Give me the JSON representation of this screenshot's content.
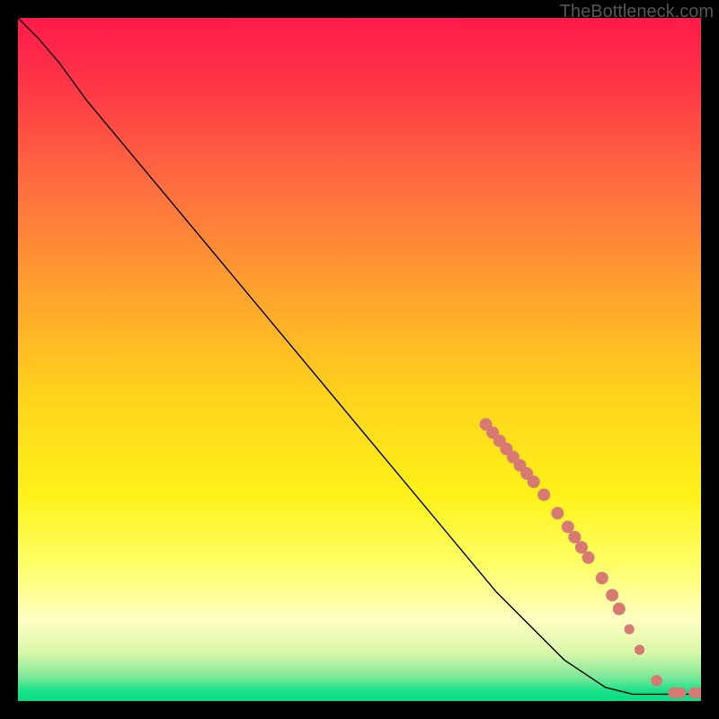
{
  "watermark": "TheBottleneck.com",
  "chart_data": {
    "type": "line",
    "title": "",
    "xlabel": "",
    "ylabel": "",
    "xlim": [
      0,
      100
    ],
    "ylim": [
      0,
      100
    ],
    "grid": false,
    "curve": [
      {
        "x": 0,
        "y": 100
      },
      {
        "x": 3,
        "y": 97
      },
      {
        "x": 6,
        "y": 93.5
      },
      {
        "x": 10,
        "y": 88
      },
      {
        "x": 20,
        "y": 76
      },
      {
        "x": 30,
        "y": 64
      },
      {
        "x": 40,
        "y": 52
      },
      {
        "x": 50,
        "y": 40
      },
      {
        "x": 60,
        "y": 28
      },
      {
        "x": 70,
        "y": 16
      },
      {
        "x": 80,
        "y": 6
      },
      {
        "x": 86,
        "y": 2
      },
      {
        "x": 90,
        "y": 1
      },
      {
        "x": 95,
        "y": 1
      },
      {
        "x": 100,
        "y": 1
      }
    ],
    "markers": [
      {
        "x": 68.5,
        "y": 40.5,
        "r": 1.0
      },
      {
        "x": 69.5,
        "y": 39.3,
        "r": 1.0
      },
      {
        "x": 70.5,
        "y": 38.1,
        "r": 1.0
      },
      {
        "x": 71.5,
        "y": 36.9,
        "r": 1.0
      },
      {
        "x": 72.5,
        "y": 35.7,
        "r": 1.0
      },
      {
        "x": 73.5,
        "y": 34.5,
        "r": 1.0
      },
      {
        "x": 74.5,
        "y": 33.3,
        "r": 1.0
      },
      {
        "x": 75.5,
        "y": 32.1,
        "r": 1.0
      },
      {
        "x": 77.0,
        "y": 30.2,
        "r": 1.0
      },
      {
        "x": 79.0,
        "y": 27.5,
        "r": 1.0
      },
      {
        "x": 80.5,
        "y": 25.5,
        "r": 1.0
      },
      {
        "x": 81.5,
        "y": 24.0,
        "r": 1.0
      },
      {
        "x": 82.5,
        "y": 22.5,
        "r": 1.0
      },
      {
        "x": 83.5,
        "y": 21.0,
        "r": 1.0
      },
      {
        "x": 85.5,
        "y": 18.0,
        "r": 1.0
      },
      {
        "x": 87.0,
        "y": 15.5,
        "r": 1.0
      },
      {
        "x": 88.0,
        "y": 13.5,
        "r": 1.0
      },
      {
        "x": 89.5,
        "y": 10.5,
        "r": 0.8
      },
      {
        "x": 91.0,
        "y": 7.5,
        "r": 0.8
      },
      {
        "x": 93.5,
        "y": 3.0,
        "r": 0.9
      },
      {
        "x": 96.0,
        "y": 1.2,
        "r": 0.9
      },
      {
        "x": 97.0,
        "y": 1.2,
        "r": 0.9
      },
      {
        "x": 99.0,
        "y": 1.2,
        "r": 0.9
      },
      {
        "x": 100.0,
        "y": 1.2,
        "r": 0.9
      }
    ],
    "marker_color": "#d77a74",
    "line_color": "#000000",
    "gradient_stops": [
      {
        "offset": 0.0,
        "color": "#ff1a4b"
      },
      {
        "offset": 0.1,
        "color": "#ff3747"
      },
      {
        "offset": 0.25,
        "color": "#ff6f3f"
      },
      {
        "offset": 0.4,
        "color": "#ffa22e"
      },
      {
        "offset": 0.55,
        "color": "#ffd21c"
      },
      {
        "offset": 0.7,
        "color": "#fff21a"
      },
      {
        "offset": 0.8,
        "color": "#ffff66"
      },
      {
        "offset": 0.88,
        "color": "#ffffc2"
      },
      {
        "offset": 0.93,
        "color": "#d8f7a8"
      },
      {
        "offset": 0.965,
        "color": "#7de89a"
      },
      {
        "offset": 0.985,
        "color": "#19e388"
      },
      {
        "offset": 1.0,
        "color": "#0bdc86"
      }
    ]
  }
}
